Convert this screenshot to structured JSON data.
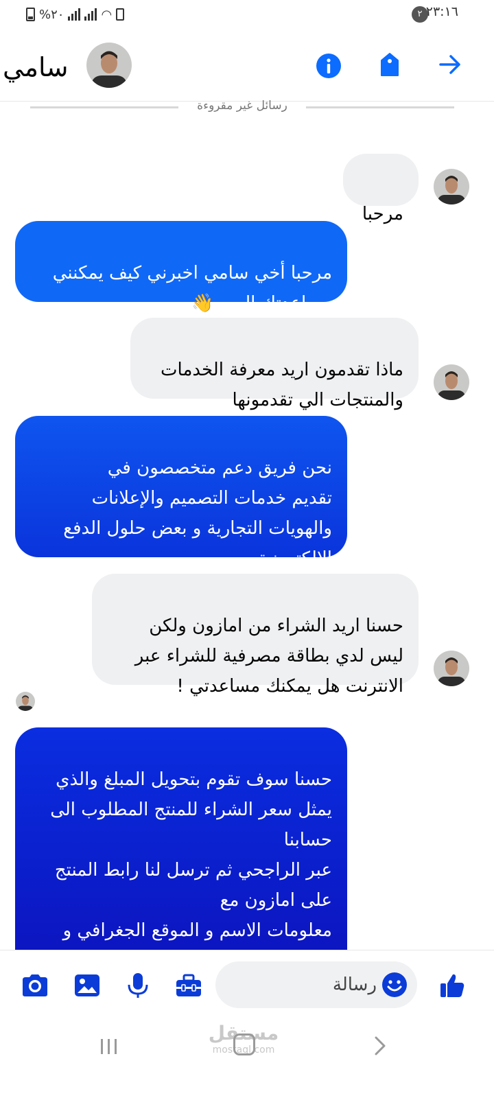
{
  "status_bar": {
    "time": "٢٣:١٦",
    "notification_count": "٢",
    "battery": "%٢٠"
  },
  "header": {
    "contact_name": "سامي",
    "icons": [
      "back-arrow-icon",
      "tag-icon",
      "info-icon"
    ],
    "accent_color": "#0b6cff"
  },
  "chat": {
    "unread_label": "رسائل غير مقروءة",
    "messages": [
      {
        "side": "incoming",
        "text": "مرحبا"
      },
      {
        "side": "outgoing",
        "text": "مرحبا أخي سامي اخبرني كيف يمكنني\nمساعدتك اليوم 👋"
      },
      {
        "side": "incoming",
        "text": "ماذا تقدمون اريد معرفة الخدمات\nوالمنتجات الي تقدمونها"
      },
      {
        "side": "outgoing",
        "text": "نحن فريق دعم متخصصون في\nتقديم خدمات التصميم والإعلانات\nوالهويات التجارية و بعض حلول الدفع\nالإلكترونية"
      },
      {
        "side": "incoming",
        "text": "حسنا اريد الشراء من امازون ولكن\nليس لدي بطاقة مصرفية للشراء عبر\nالانترنت هل يمكنك مساعدتي !"
      },
      {
        "side": "outgoing",
        "text": "حسنا سوف تقوم بتحويل المبلغ والذي\nيمثل سعر الشراء للمنتج المطلوب الى\nحسابنا\nعبر الراجحي ثم ترسل لنا رابط المنتج\nعلى امازون مع\nمعلومات الاسم و الموقع الجغرافي و\nرقم حسابك لدى"
      }
    ],
    "outgoing_gradient": [
      "#1877f2",
      "#0a1fd6",
      "#0c11b8"
    ],
    "incoming_color": "#eff0f2"
  },
  "composer": {
    "placeholder": "رسالة",
    "icons": [
      "like-icon",
      "emoji-icon",
      "toolbox-icon",
      "microphone-icon",
      "image-icon",
      "camera-icon"
    ]
  },
  "nav": {
    "watermark_arabic": "مستقل",
    "watermark_latin": "mostaql.com"
  }
}
